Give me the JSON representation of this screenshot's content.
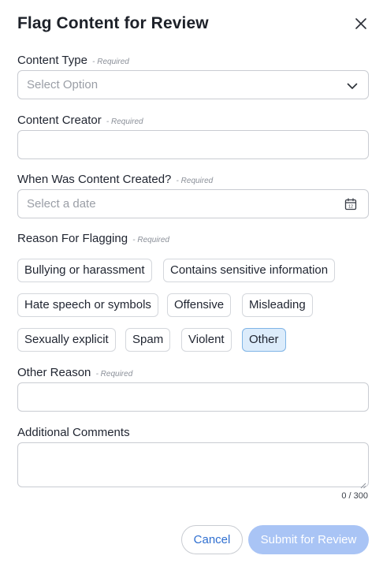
{
  "dialog": {
    "title": "Flag Content for Review",
    "close_icon": "close-icon"
  },
  "fields": {
    "required_tag": "- Required",
    "content_type": {
      "label": "Content Type",
      "placeholder": "Select Option",
      "icon": "chevron-down-icon"
    },
    "content_creator": {
      "label": "Content Creator",
      "value": ""
    },
    "created_date": {
      "label": "When Was Content Created?",
      "placeholder": "Select a date",
      "icon": "calendar-icon",
      "calendar_day": "12"
    },
    "reason": {
      "label": "Reason For Flagging",
      "options": [
        {
          "label": "Bullying or harassment",
          "selected": false
        },
        {
          "label": "Contains sensitive information",
          "selected": false
        },
        {
          "label": "Hate speech or symbols",
          "selected": false
        },
        {
          "label": "Offensive",
          "selected": false
        },
        {
          "label": "Misleading",
          "selected": false
        },
        {
          "label": "Sexually explicit",
          "selected": false
        },
        {
          "label": "Spam",
          "selected": false
        },
        {
          "label": "Violent",
          "selected": false
        },
        {
          "label": "Other",
          "selected": true
        }
      ]
    },
    "other_reason": {
      "label": "Other Reason",
      "value": ""
    },
    "additional_comments": {
      "label": "Additional Comments",
      "value": "",
      "counter": "0 / 300"
    }
  },
  "actions": {
    "cancel_label": "Cancel",
    "submit_label": "Submit for Review"
  },
  "colors": {
    "accent": "#2f6fd0",
    "submit_disabled_bg": "#a9c4f5",
    "selected_chip_bg": "#dcecfb",
    "selected_chip_border": "#7fb4e6"
  }
}
